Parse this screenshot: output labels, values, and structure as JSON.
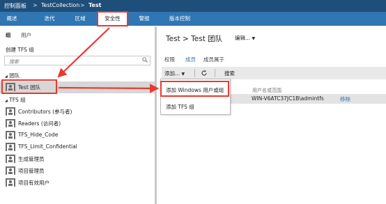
{
  "breadcrumb": {
    "root": "控制面板",
    "separator": ">",
    "collection": "TestCollection",
    "project": "Test"
  },
  "tabs": [
    {
      "label": "概述",
      "active": false
    },
    {
      "label": "迭代",
      "active": false
    },
    {
      "label": "区域",
      "active": false
    },
    {
      "label": "安全性",
      "active": true
    },
    {
      "label": "警报",
      "active": false
    },
    {
      "label": "版本控制",
      "active": false
    }
  ],
  "left_panel": {
    "mode_group": "组",
    "mode_user": "用户",
    "create_group": "创建 TFS 组",
    "search_placeholder": "搜索",
    "section_teams": "团队",
    "teams": [
      {
        "label": "Test 团队",
        "selected": true
      }
    ],
    "section_tfs_groups": "TFS 组",
    "groups": [
      {
        "label": "Contributors (参与者)"
      },
      {
        "label": "Readers (访问者)"
      },
      {
        "label": "TFS_Hide_Code"
      },
      {
        "label": "TFS_Limit_Confidential"
      },
      {
        "label": "生成管理员"
      },
      {
        "label": "项目管理员"
      },
      {
        "label": "项目有效用户"
      }
    ]
  },
  "right_panel": {
    "title": "Test > Test 团队",
    "edit_menu": "编辑...",
    "subtabs": [
      {
        "label": "权限",
        "active": false
      },
      {
        "label": "成员",
        "active": true
      },
      {
        "label": "成员属于",
        "active": false
      }
    ],
    "toolbar": {
      "add": "添加...",
      "search": "搜索"
    },
    "column_header": "用户名或范围",
    "members": [
      {
        "account": "WIN-V6ATC37JC1B\\admintfs",
        "action": "移除"
      }
    ]
  },
  "dropdown": {
    "items": [
      {
        "label": "添加 Windows 用户或组",
        "highlighted": true
      },
      {
        "label": "添加 TFS 组",
        "highlighted": false
      }
    ]
  },
  "colors": {
    "topbar": "#1e4e7a",
    "tabbar": "#2f76b3",
    "highlight": "#e8392f",
    "link": "#2f76b3"
  }
}
